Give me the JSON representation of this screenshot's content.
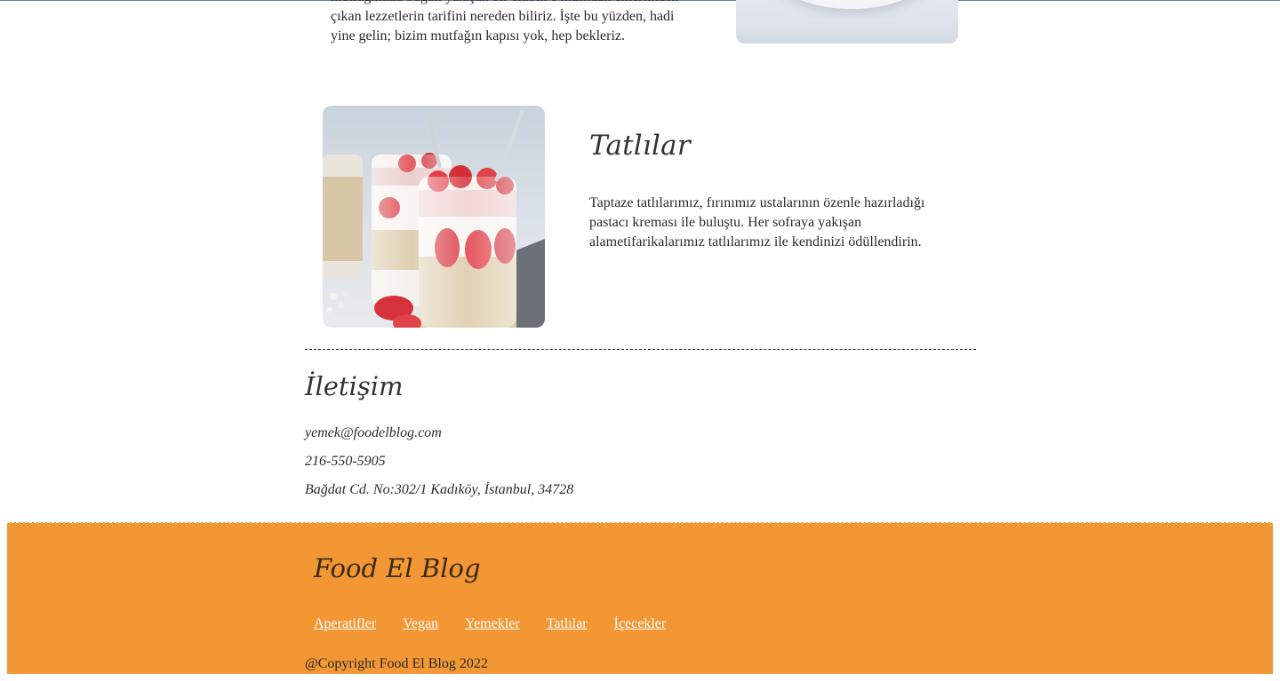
{
  "previous_section": {
    "text_lines": [
      "mutfağımıza bugün yakışan bir ekibin e mulitdan emerlikden",
      "çıkan lezzetlerin tarifini nereden biliriz. İşte bu yüzden, hadi",
      "yine gelin; bizim mutfağın kapısı yok, hep bekleriz."
    ]
  },
  "desserts": {
    "title": "Tatlılar",
    "text_lines": [
      "Taptaze tatlılarımız, fırınımız ustalarının özenle hazırladığı",
      "pastacı kreması ile buluştu. Her sofraya yakışan",
      "alametifarikalarımız tatlılarımız ile kendinizi ödüllendirin."
    ]
  },
  "contact": {
    "title": "İletişim",
    "email": "yemek@foodelblog.com",
    "phone": "216-550-5905",
    "address": "Bağdat Cd. No:302/1 Kadıköy, İstanbul, 34728"
  },
  "footer": {
    "brand": "Food El Blog",
    "nav": [
      "Aperatifler",
      "Vegan",
      "Yemekler",
      "Tatlılar",
      "İçecekler"
    ],
    "copyright": "@Copyright Food El Blog 2022"
  },
  "colors": {
    "footer_bg": "#f29733",
    "footer_link": "#ffffff",
    "text": "#2b2b2b"
  }
}
